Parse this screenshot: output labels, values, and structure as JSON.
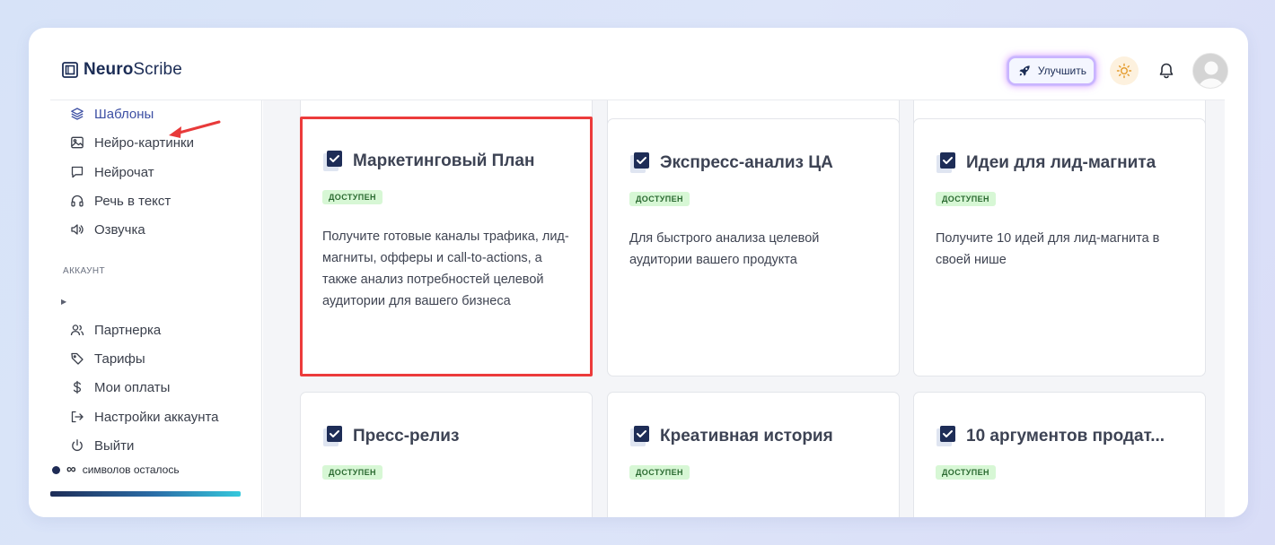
{
  "header": {
    "logo_bold": "Neuro",
    "logo_rest": "Scribe",
    "upgrade_label": "Улучшить"
  },
  "sidebar": {
    "items": [
      {
        "label": "Шаблоны",
        "icon": "layers-icon",
        "active": true
      },
      {
        "label": "Нейро-картинки",
        "icon": "image-icon"
      },
      {
        "label": "Нейрочат",
        "icon": "chat-icon"
      },
      {
        "label": "Речь в текст",
        "icon": "headphones-icon"
      },
      {
        "label": "Озвучка",
        "icon": "speaker-icon"
      }
    ],
    "section_label": "АККАУНТ",
    "account_items": [
      {
        "label": "Партнерка",
        "icon": "users-icon"
      },
      {
        "label": "Тарифы",
        "icon": "tag-icon"
      },
      {
        "label": "Мои оплаты",
        "icon": "dollar-icon"
      },
      {
        "label": "Настройки аккаунта",
        "icon": "logout-arrow-icon"
      },
      {
        "label": "Выйти",
        "icon": "power-icon"
      }
    ],
    "credits_symbol": "∞",
    "credits_label": "символов осталось"
  },
  "cards": [
    {
      "title": "Маркетинговый План",
      "badge": "ДОСТУПЕН",
      "description": "Получите готовые каналы трафика, лид-магниты, офферы и call-to-actions, а также анализ потребностей целевой аудитории для вашего бизнеса",
      "highlighted": true
    },
    {
      "title": "Экспресс-анализ ЦА",
      "badge": "ДОСТУПЕН",
      "description": "Для быстрого анализа целевой аудитории вашего продукта"
    },
    {
      "title": "Идеи для лид-магнита",
      "badge": "ДОСТУПЕН",
      "description": "Получите 10 идей для лид-магнита в своей нише"
    },
    {
      "title": "Пресс-релиз",
      "badge": "ДОСТУПЕН",
      "description": ""
    },
    {
      "title": "Креативная история",
      "badge": "ДОСТУПЕН",
      "description": ""
    },
    {
      "title": "10 аргументов продат...",
      "badge": "ДОСТУПЕН",
      "description": ""
    }
  ],
  "colors": {
    "accent_navy": "#1e2b55",
    "highlight_red": "#ec3b3b",
    "badge_green_bg": "#d7f7d5",
    "active_nav": "#3c4fa3"
  }
}
